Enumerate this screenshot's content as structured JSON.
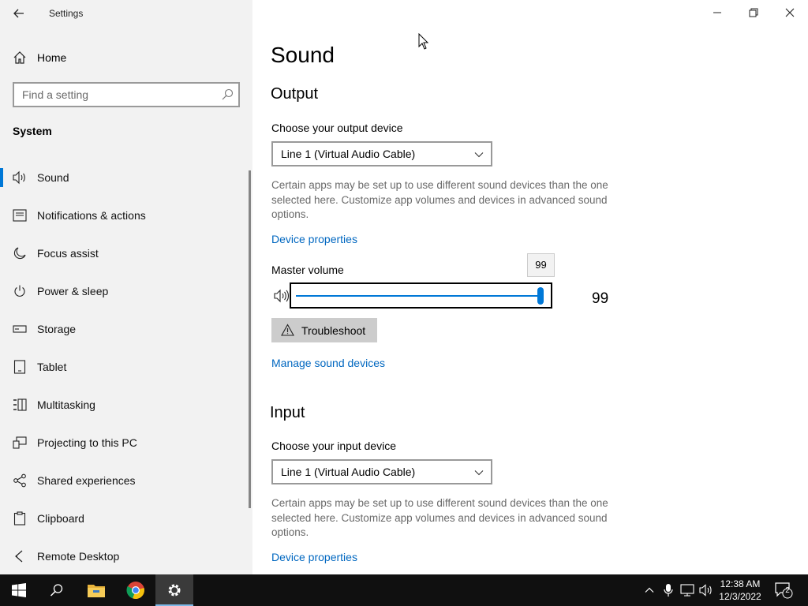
{
  "window": {
    "title": "Settings",
    "back_label": "Back",
    "minimize_label": "Minimize",
    "restore_label": "Restore",
    "close_label": "Close"
  },
  "sidebar": {
    "home_label": "Home",
    "search_placeholder": "Find a setting",
    "group_title": "System",
    "items": [
      {
        "label": "Sound",
        "icon": "speaker-icon",
        "active": true
      },
      {
        "label": "Notifications & actions",
        "icon": "notifications-icon"
      },
      {
        "label": "Focus assist",
        "icon": "moon-icon"
      },
      {
        "label": "Power & sleep",
        "icon": "power-icon"
      },
      {
        "label": "Storage",
        "icon": "storage-icon"
      },
      {
        "label": "Tablet",
        "icon": "tablet-icon"
      },
      {
        "label": "Multitasking",
        "icon": "multitasking-icon"
      },
      {
        "label": "Projecting to this PC",
        "icon": "projecting-icon"
      },
      {
        "label": "Shared experiences",
        "icon": "shared-experiences-icon"
      },
      {
        "label": "Clipboard",
        "icon": "clipboard-icon"
      },
      {
        "label": "Remote Desktop",
        "icon": "remote-desktop-icon"
      }
    ]
  },
  "main": {
    "page_title": "Sound",
    "output": {
      "title": "Output",
      "device_label": "Choose your output device",
      "device_value": "Line 1 (Virtual Audio Cable)",
      "help_text": "Certain apps may be set up to use different sound devices than the one selected here. Customize app volumes and devices in advanced sound options.",
      "device_properties": "Device properties",
      "master_volume_label": "Master volume",
      "volume_tooltip": "99",
      "volume_value": "99",
      "volume_level": 99,
      "troubleshoot_label": "Troubleshoot",
      "manage_devices": "Manage sound devices"
    },
    "input": {
      "title": "Input",
      "device_label": "Choose your input device",
      "device_value": "Line 1 (Virtual Audio Cable)",
      "help_text": "Certain apps may be set up to use different sound devices than the one selected here. Customize app volumes and devices in advanced sound options.",
      "device_properties": "Device properties"
    }
  },
  "taskbar": {
    "time": "12:38 AM",
    "date": "12/3/2022",
    "notification_count": "2"
  },
  "colors": {
    "accent": "#0078d7",
    "link": "#0067c0",
    "sidebar_bg": "#f2f2f2",
    "taskbar_bg": "#101010"
  }
}
